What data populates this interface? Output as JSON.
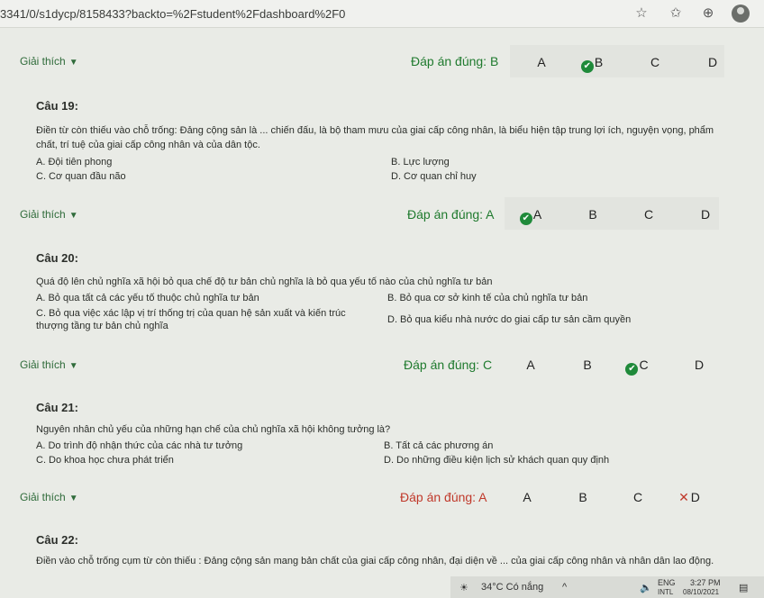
{
  "browser": {
    "url": "3341/0/s1dycp/8158433?backto=%2Fstudent%2Fdashboard%2F0"
  },
  "explain_label": "Giải thích",
  "options": [
    "A",
    "B",
    "C",
    "D"
  ],
  "rows": [
    {
      "answer": "Đáp án đúng: B",
      "correct": "B",
      "wrong": false
    },
    {
      "answer": "Đáp án đúng: A",
      "correct": "A",
      "wrong": false
    },
    {
      "answer": "Đáp án đúng: C",
      "correct": "C",
      "wrong": false
    },
    {
      "answer": "Đáp án đúng: A",
      "correct": null,
      "wrong": true,
      "wrong_choice": "D"
    }
  ],
  "questions": [
    {
      "title": "Câu 19:",
      "text": "Điền từ còn thiếu vào chỗ trống: Đảng cộng sản là ... chiến đấu, là bộ tham mưu của giai cấp công nhân, là biểu hiện tập trung lợi ích, nguyện vọng, phẩm chất, trí tuệ của giai cấp công nhân và của dân tộc.",
      "A": "A. Đội tiên phong",
      "B": "B. Lực lượng",
      "C": "C. Cơ quan đầu não",
      "D": "D. Cơ quan chỉ huy"
    },
    {
      "title": "Câu 20:",
      "text": "Quá độ lên chủ nghĩa xã hội bỏ qua chế độ tư bản chủ nghĩa là bỏ qua yếu tố nào của chủ nghĩa tư bản",
      "A": "A. Bỏ qua tất cả các yếu tố thuộc chủ nghĩa tư bản",
      "B": "B. Bỏ qua cơ sở kinh tế của chủ nghĩa tư bản",
      "C": "C. Bỏ qua việc xác lập vị trí thống trị của quan hệ sản xuất và kiến trúc thượng tầng tư bản chủ nghĩa",
      "D": "D. Bỏ qua kiểu nhà nước do giai cấp tư sản cầm quyền"
    },
    {
      "title": "Câu 21:",
      "text": "Nguyên nhân chủ yếu của những hạn chế của chủ nghĩa xã hội không tưởng là?",
      "A": "A. Do trình độ nhận thức của các nhà tư tưởng",
      "B": "B. Tất cả các phương án",
      "C": "C. Do khoa học chưa phát triển",
      "D": "D. Do những điều kiện lịch sử khách quan quy định"
    },
    {
      "title": "Câu 22:",
      "text": "Điền vào chỗ trống cụm từ còn thiếu : Đảng cộng sản mang bản chất của giai cấp công nhân, đại diện về ... của giai cấp công nhân và nhân dân lao động."
    }
  ],
  "taskbar": {
    "weather": "34°C  Có nắng",
    "lang": "ENG",
    "lang2": "INTL",
    "time": "3:27 PM",
    "date": "08/10/2021"
  },
  "colors": {
    "correct": "#1f7a2e",
    "wrong": "#c0392b",
    "check": "#1f8a3a"
  }
}
